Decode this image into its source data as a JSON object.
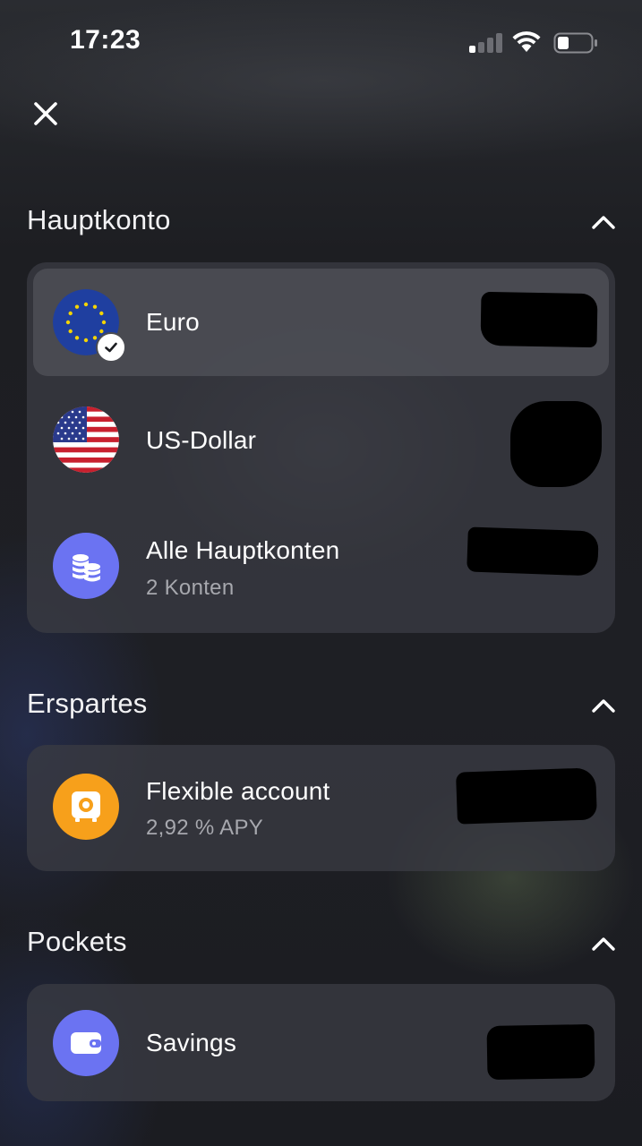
{
  "status_bar": {
    "time": "17:23"
  },
  "icons": {
    "close": "close-icon",
    "chevron": "chevron-up-icon"
  },
  "sections": {
    "hauptkonto": {
      "title": "Hauptkonto",
      "accounts": [
        {
          "name": "Euro",
          "icon": "eu-flag-icon",
          "selected": true
        },
        {
          "name": "US-Dollar",
          "icon": "us-flag-icon",
          "selected": false
        },
        {
          "name": "Alle Hauptkonten",
          "subtitle": "2 Konten",
          "icon": "coins-icon",
          "selected": false
        }
      ]
    },
    "erspartes": {
      "title": "Erspartes",
      "accounts": [
        {
          "name": "Flexible account",
          "subtitle": "2,92 % APY",
          "icon": "safe-icon"
        }
      ]
    },
    "pockets": {
      "title": "Pockets",
      "accounts": [
        {
          "name": "Savings",
          "icon": "wallet-icon"
        }
      ]
    }
  },
  "colors": {
    "accent_blue": "#6b73f2",
    "accent_orange": "#f7a01b",
    "eu_blue": "#1f3fa0",
    "eu_star": "#f5d400",
    "us_red": "#c8202e"
  }
}
